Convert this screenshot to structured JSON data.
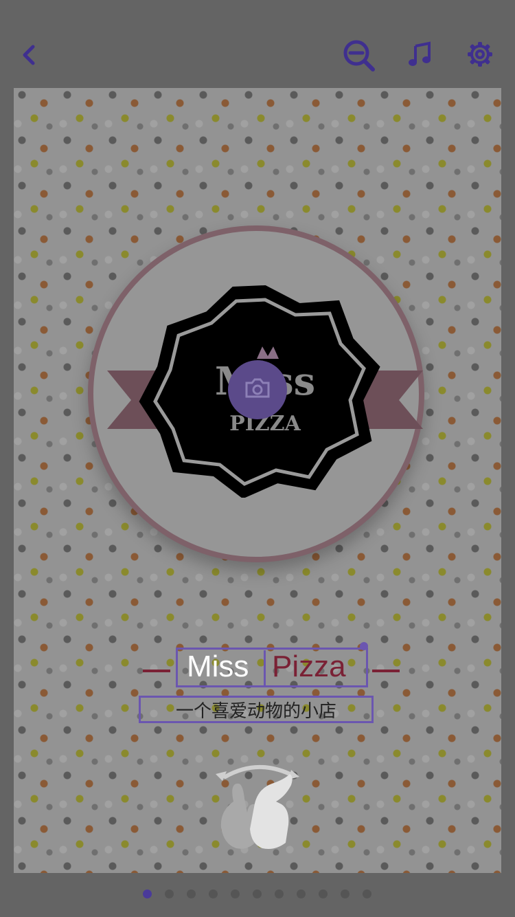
{
  "topbar": {
    "icons": [
      "back-icon",
      "zoom-out-icon",
      "music-icon",
      "gear-icon"
    ]
  },
  "card": {
    "logo": {
      "title": "Miss",
      "sub": "PIZZA"
    },
    "heading": {
      "word1": "Miss",
      "word2": "Pizza"
    },
    "subtitle": "一个喜爱动物的小店"
  },
  "pagination": {
    "total": 11,
    "active_index": 0
  },
  "colors": {
    "accent": "#4a3a9a",
    "brand": "#7a2135",
    "background": "#646464"
  }
}
